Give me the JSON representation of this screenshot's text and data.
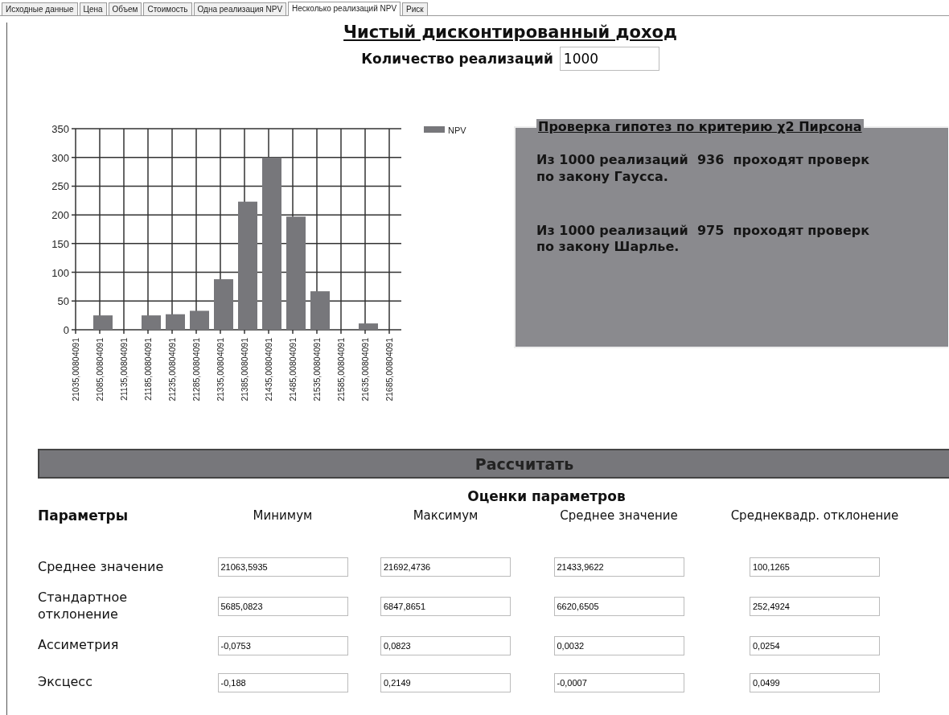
{
  "tabs": [
    {
      "label": "Исходные данные",
      "selected": false
    },
    {
      "label": "Цена",
      "selected": false
    },
    {
      "label": "Объем",
      "selected": false
    },
    {
      "label": "Стоимость",
      "selected": false
    },
    {
      "label": "Одна реализация NPV",
      "selected": false
    },
    {
      "label": "Несколько реализаций NPV",
      "selected": true
    },
    {
      "label": "Риск",
      "selected": false
    }
  ],
  "title": "Чистый дисконтированный доход",
  "realizations": {
    "label": "Количество реализаций",
    "value": "1000"
  },
  "chart_data": {
    "type": "bar",
    "categories": [
      "21035,00804091",
      "21085,00804091",
      "21135,00804091",
      "21185,00804091",
      "21235,00804091",
      "21285,00804091",
      "21335,00804091",
      "21385,00804091",
      "21435,00804091",
      "21485,00804091",
      "21535,00804091",
      "21585,00804091",
      "21635,00804091",
      "21685,00804091"
    ],
    "series": [
      {
        "name": "NPV",
        "color": "#77777b",
        "values": [
          0,
          25,
          0,
          25,
          27,
          33,
          88,
          223,
          300,
          197,
          67,
          0,
          11,
          0
        ]
      }
    ],
    "grid": true,
    "ylim": [
      0,
      350
    ],
    "yticks": [
      0,
      50,
      100,
      150,
      200,
      250,
      300,
      350
    ]
  },
  "hypothesis": {
    "title": "Проверка гипотез по критерию χ2 Пирсона",
    "results": [
      "Из 1000 реализаций  936  проходят проверк\nпо закону Гаусса.",
      "Из 1000 реализаций  975  проходят проверк\nпо закону Шарлье."
    ]
  },
  "calculate_button": "Рассчитать",
  "estimates": {
    "title": "Оценки параметров",
    "columns": [
      "Параметры",
      "Минимум",
      "Максимум",
      "Среднее значение",
      "Среднеквадр. отклонение"
    ],
    "rows": [
      {
        "name": "Среднее значение",
        "values": [
          "21063,5935",
          "21692,4736",
          "21433,9622",
          "100,1265"
        ]
      },
      {
        "name": "Стандартное\nотклонение",
        "values": [
          "5685,0823",
          "6847,8651",
          "6620,6505",
          "252,4924"
        ]
      },
      {
        "name": "Ассиметрия",
        "values": [
          "-0,0753",
          "0,0823",
          "0,0032",
          "0,0254"
        ]
      },
      {
        "name": "Эксцесс",
        "values": [
          "-0,188",
          "0,2149",
          "-0,0007",
          "0,0499"
        ]
      }
    ]
  }
}
